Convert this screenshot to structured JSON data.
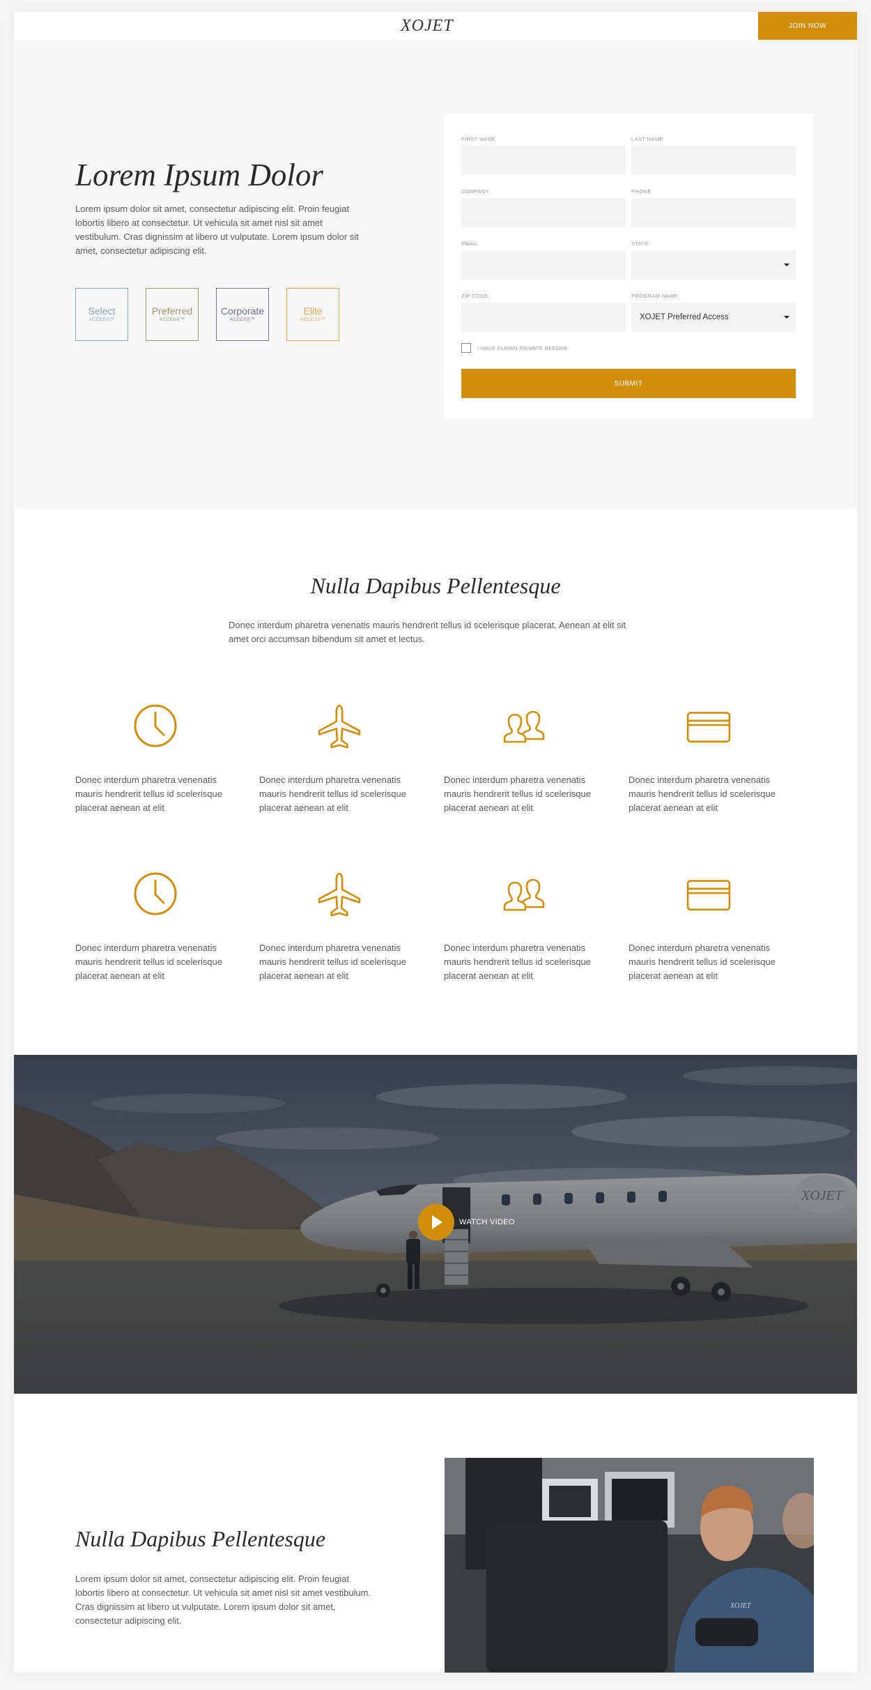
{
  "header": {
    "logo": "XOJET",
    "join_label": "JOIN NOW"
  },
  "hero": {
    "title": "Lorem Ipsum Dolor",
    "text": "Lorem ipsum dolor sit amet, consectetur adipiscing elit. Proin feugiat lobortis libero at consectetur. Ut vehicula sit amet nisl sit amet vestibulum. Cras dignissim at libero ut vulputate. Lorem ipsum dolor sit amet, consectetur adipiscing elit.",
    "access": [
      {
        "name": "Select",
        "sub": "ACCESS™",
        "color": "#8ba3c1"
      },
      {
        "name": "Preferred",
        "sub": "ACCESS™",
        "color": "#9a9a6e"
      },
      {
        "name": "Corporate",
        "sub": "ACCESS™",
        "color": "#6f7782"
      },
      {
        "name": "Elite",
        "sub": "ACCESS™",
        "color": "#e0a45b"
      }
    ]
  },
  "form": {
    "first_name_label": "FIRST NAME",
    "last_name_label": "LAST NAME",
    "company_label": "COMPANY",
    "phone_label": "PHONE",
    "email_label": "EMAIL",
    "state_label": "STATE",
    "zip_label": "ZIP CODE",
    "program_label": "PROGRAM NAME",
    "program_value": "XOJET Preferred Access",
    "flown_label": "I HAVE FLOWN PRIVATE BEFORE",
    "submit_label": "SUBMIT"
  },
  "features": {
    "title": "Nulla Dapibus Pellentesque",
    "text": "Donec interdum pharetra venenatis mauris hendrerit tellus id scelerisque placerat. Aenean at elit sit amet orci accumsan bibendum sit amet et lectus.",
    "accent": "#d18e08",
    "items": [
      {
        "icon": "clock-icon",
        "text": "Donec interdum pharetra venenatis mauris hendrerit tellus id scelerisque placerat aenean at elit"
      },
      {
        "icon": "airplane-icon",
        "text": "Donec interdum pharetra venenatis mauris hendrerit tellus id scelerisque placerat aenean at elit"
      },
      {
        "icon": "people-icon",
        "text": "Donec interdum pharetra venenatis mauris hendrerit tellus id scelerisque placerat aenean at elit"
      },
      {
        "icon": "credit-card-icon",
        "text": "Donec interdum pharetra venenatis mauris hendrerit tellus id scelerisque placerat aenean at elit"
      },
      {
        "icon": "clock-icon",
        "text": "Donec interdum pharetra venenatis mauris hendrerit tellus id scelerisque placerat aenean at elit"
      },
      {
        "icon": "airplane-icon",
        "text": "Donec interdum pharetra venenatis mauris hendrerit tellus id scelerisque placerat aenean at elit"
      },
      {
        "icon": "people-icon",
        "text": "Donec interdum pharetra venenatis mauris hendrerit tellus id scelerisque placerat aenean at elit"
      },
      {
        "icon": "credit-card-icon",
        "text": "Donec interdum pharetra venenatis mauris hendrerit tellus id scelerisque placerat aenean at elit"
      }
    ]
  },
  "video": {
    "watch_label": "WATCH VIDEO",
    "jet_logo": "XOJET"
  },
  "bottom": {
    "title": "Nulla Dapibus Pellentesque",
    "text": "Lorem ipsum dolor sit amet, consectetur adipiscing elit. Proin feugiat lobortis libero at consectetur. Ut vehicula sit amet nisl sit amet vestibulum. Cras dignissim at libero ut vulputate. Lorem ipsum dolor sit amet, consectetur adipiscing elit.",
    "shirt_logo": "XOJET"
  }
}
